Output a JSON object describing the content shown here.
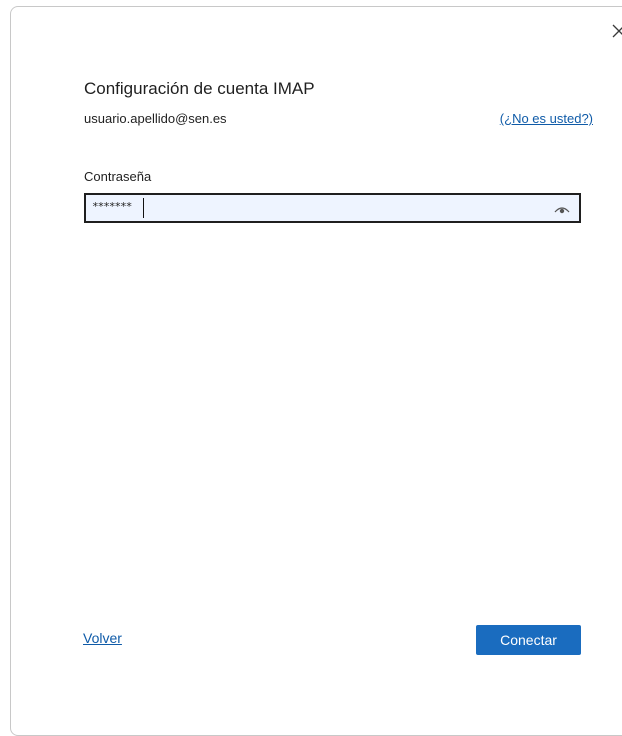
{
  "dialog": {
    "title": "Configuración de cuenta IMAP",
    "email": "usuario.apellido@sen.es",
    "not_you_link": "(¿No es usted?)",
    "password_label": "Contraseña",
    "password_value": "*******",
    "back_link": "Volver",
    "connect_button": "Conectar"
  },
  "icons": {
    "close": "close-icon",
    "reveal_password": "eye-icon"
  },
  "colors": {
    "link": "#0f5ba8",
    "primary_button": "#1a6cbf",
    "input_background": "#eef4ff"
  }
}
